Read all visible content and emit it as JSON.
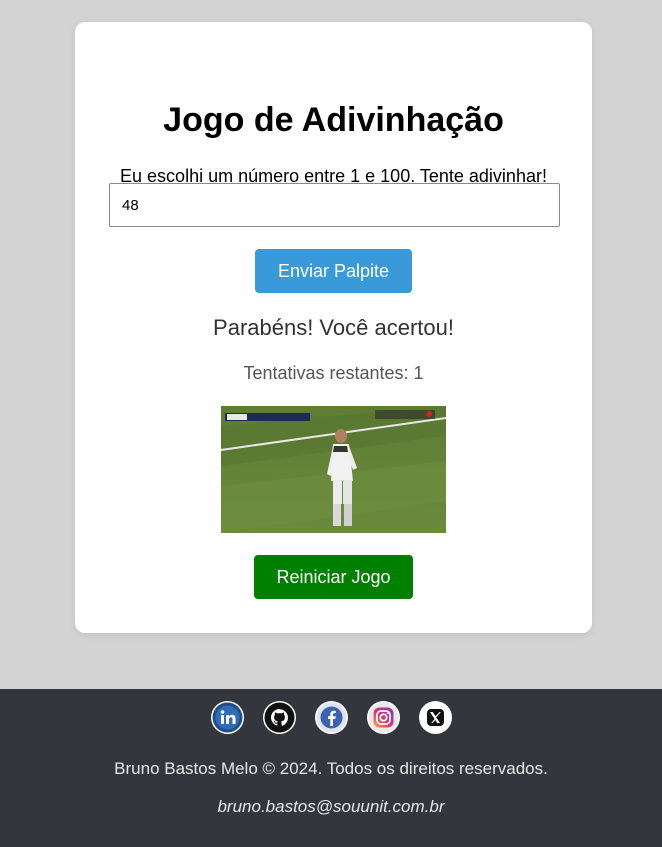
{
  "game": {
    "title": "Jogo de Adivinhação",
    "instructions": "Eu escolhi um número entre 1 e 100. Tente adivinhar!",
    "guess_value": "48",
    "send_label": "Enviar Palpite",
    "result_message": "Parabéns! Você acertou!",
    "attempts_text": "Tentativas restantes: 1",
    "reset_label": "Reiniciar Jogo",
    "image_icon": "celebration-gif-soccer-player"
  },
  "footer": {
    "socials": [
      {
        "name": "linkedin",
        "icon": "linkedin-icon"
      },
      {
        "name": "github",
        "icon": "github-icon"
      },
      {
        "name": "facebook",
        "icon": "facebook-icon"
      },
      {
        "name": "instagram",
        "icon": "instagram-icon"
      },
      {
        "name": "x",
        "icon": "x-icon"
      }
    ],
    "copyright": "Bruno Bastos Melo © 2024. Todos os direitos reservados.",
    "email": "bruno.bastos@souunit.com.br"
  },
  "colors": {
    "page_bg": "#d3d3d3",
    "send_button": "#3a9ad9",
    "reset_button": "#008000",
    "footer_bg": "#33373d"
  }
}
